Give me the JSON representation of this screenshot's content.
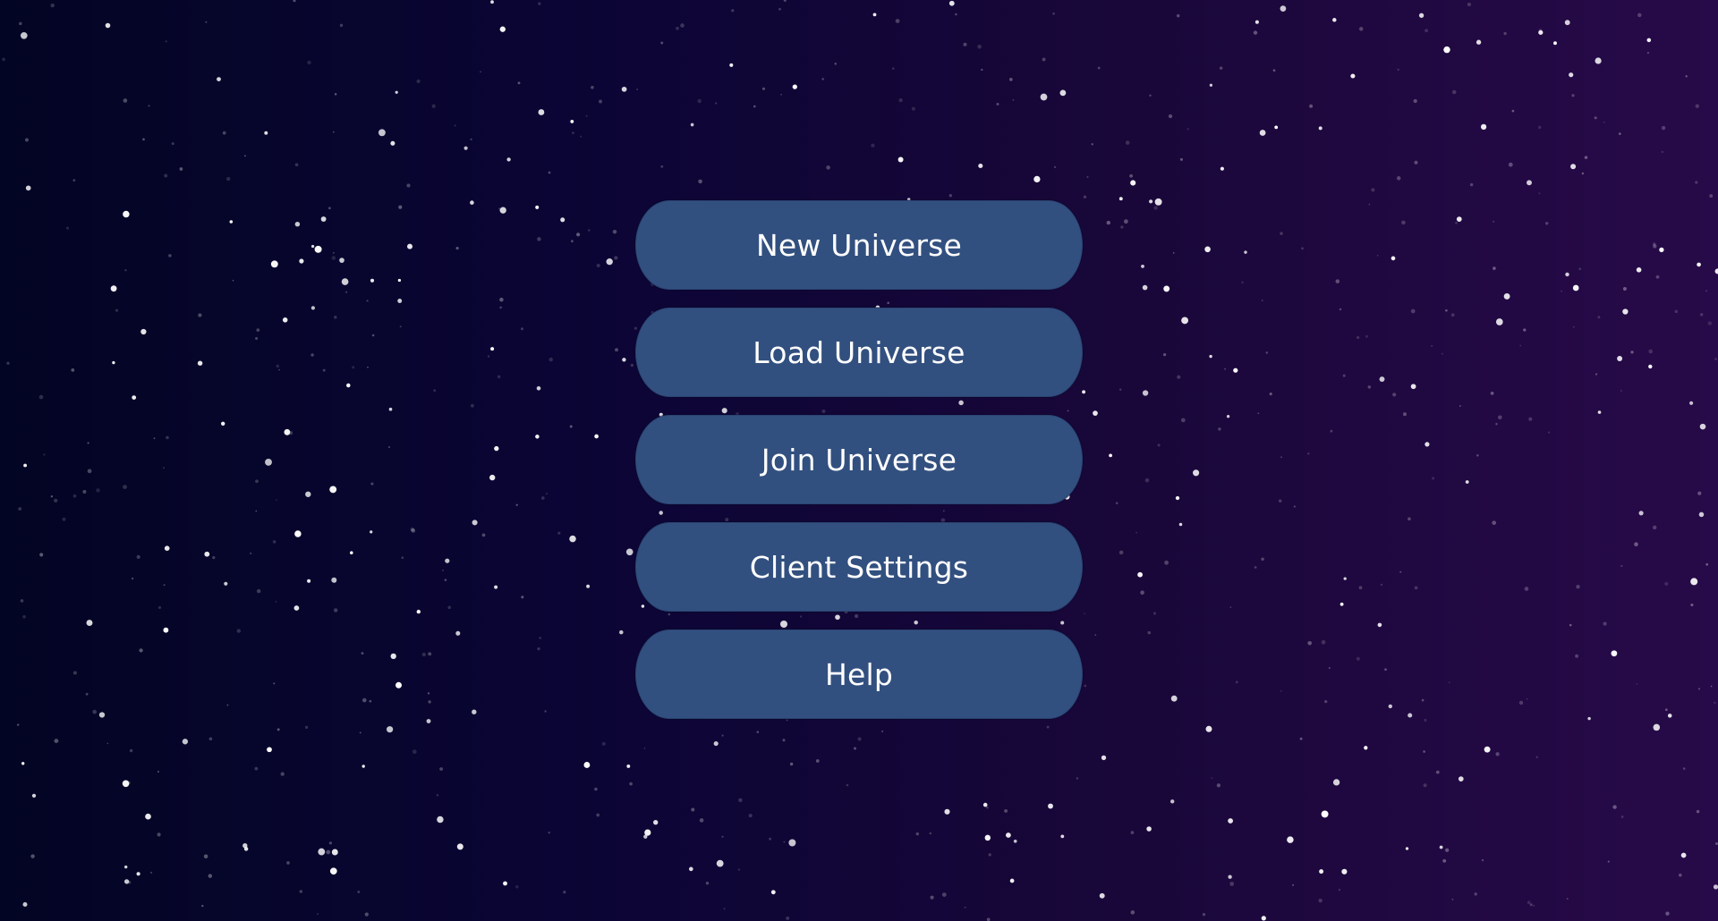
{
  "menu": {
    "items": [
      {
        "label": "New Universe"
      },
      {
        "label": "Load Universe"
      },
      {
        "label": "Join Universe"
      },
      {
        "label": "Client Settings"
      },
      {
        "label": "Help"
      }
    ]
  },
  "colors": {
    "background_start": "#030524",
    "background_end": "#270a49",
    "button_fill": "#32507f",
    "button_text": "#ffffff",
    "star": "#ffffff"
  }
}
